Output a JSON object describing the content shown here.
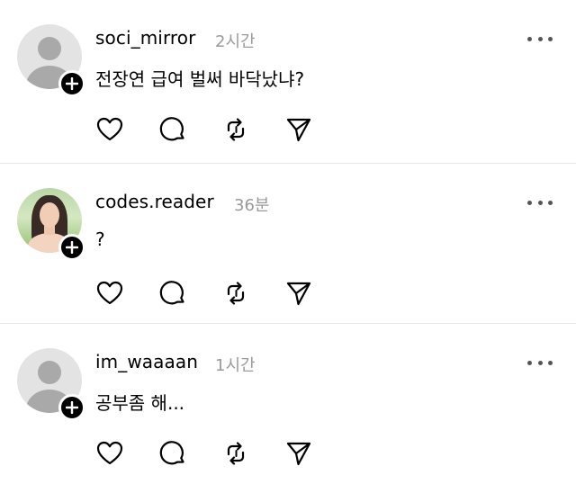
{
  "posts": [
    {
      "username": "soci_mirror",
      "time": "2시간",
      "text": "전장연 급여 벌써 바닥났냐?",
      "avatar": "default-avatar"
    },
    {
      "username": "codes.reader",
      "time": "36분",
      "text": "?",
      "avatar": "photo-avatar"
    },
    {
      "username": "im_waaaan",
      "time": "1시간",
      "text": "공부좀 해...",
      "avatar": "default-avatar"
    }
  ],
  "icons": {
    "like": "heart-icon",
    "comment": "comment-bubble-icon",
    "repost": "repost-icon",
    "share": "send-icon",
    "more": "more-dots-icon",
    "follow": "plus-icon"
  },
  "colors": {
    "text": "#000000",
    "muted": "#9a9a9a",
    "divider": "#e6e6e6",
    "avatar_placeholder": "#e3e3e3"
  }
}
